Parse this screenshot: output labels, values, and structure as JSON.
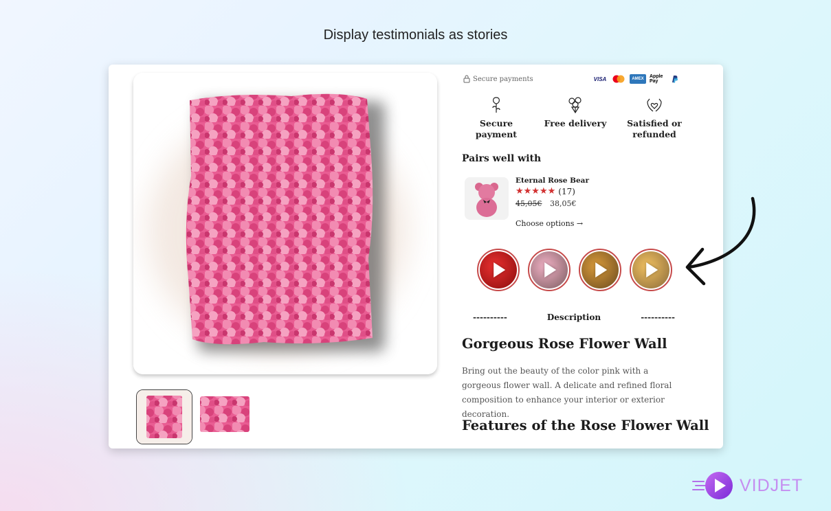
{
  "headline": "Display testimonials as stories",
  "secure": {
    "label": "Secure payments",
    "methods": [
      "VISA",
      "mastercard",
      "AMEX",
      "Apple Pay",
      "PayPal"
    ]
  },
  "features": [
    {
      "label": "Secure payment",
      "icon": "rose-icon"
    },
    {
      "label": "Free delivery",
      "icon": "flower-bouquet-icon"
    },
    {
      "label": "Satisfied or refunded",
      "icon": "hands-heart-icon"
    }
  ],
  "pairs": {
    "title": "Pairs well with",
    "product": {
      "name": "Eternal Rose Bear",
      "stars": "★★★★★",
      "review_count": "(17)",
      "old_price": "45,05€",
      "price": "38,05€",
      "cta": "Choose options →"
    }
  },
  "stories": [
    {
      "name": "story-1",
      "colors": [
        "#d01818",
        "#8a0c0c"
      ]
    },
    {
      "name": "story-2",
      "colors": [
        "#e9a0b6",
        "#7b5c60"
      ]
    },
    {
      "name": "story-3",
      "colors": [
        "#c78a2d",
        "#6a4a20"
      ]
    },
    {
      "name": "story-4",
      "colors": [
        "#e8b04a",
        "#8a6a3a"
      ]
    }
  ],
  "description": {
    "left": "----------",
    "label": "Description",
    "right": "----------"
  },
  "product": {
    "title": "Gorgeous Rose Flower Wall",
    "text": "Bring out the beauty of the color pink with a gorgeous flower wall. A delicate and refined floral composition to enhance your interior or exterior decoration.",
    "features_title": "Features of the Rose Flower Wall"
  },
  "brand": {
    "logo_text": "VIDJET",
    "accent": "#c58ef0",
    "pink": "#e0508a",
    "star_color": "#d23131"
  }
}
